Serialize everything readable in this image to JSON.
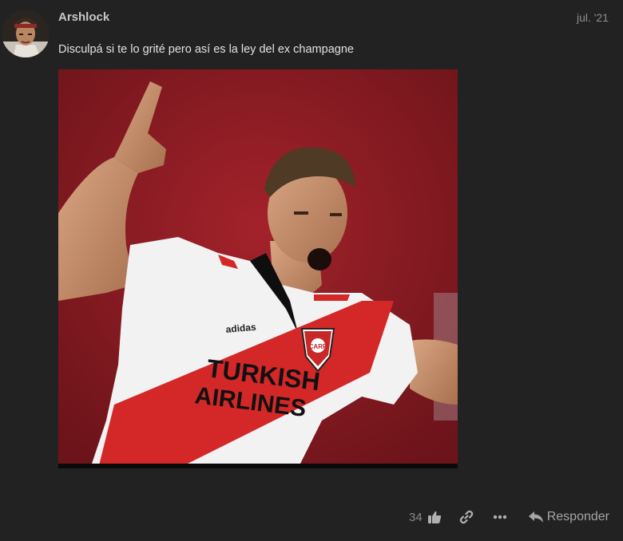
{
  "post": {
    "username": "Arshlock",
    "date": "jul. '21",
    "text": "Disculpá si te lo grité pero así es la ley del ex champagne",
    "avatar_icon": "user-avatar",
    "image": {
      "jersey_brand": "adidas",
      "sponsor_line1": "TURKISH",
      "sponsor_line2": "AIRLINES",
      "crest_text": "CARP"
    }
  },
  "actions": {
    "like_count": "34",
    "like_icon": "thumbs-up-icon",
    "link_icon": "link-icon",
    "more_icon": "ellipsis-icon",
    "reply_icon": "reply-arrow-icon",
    "reply_label": "Responder"
  },
  "colors": {
    "background": "#222222",
    "text": "#e2e2e2",
    "muted": "#8f8f8f",
    "image_bg": "#8a1b22"
  }
}
